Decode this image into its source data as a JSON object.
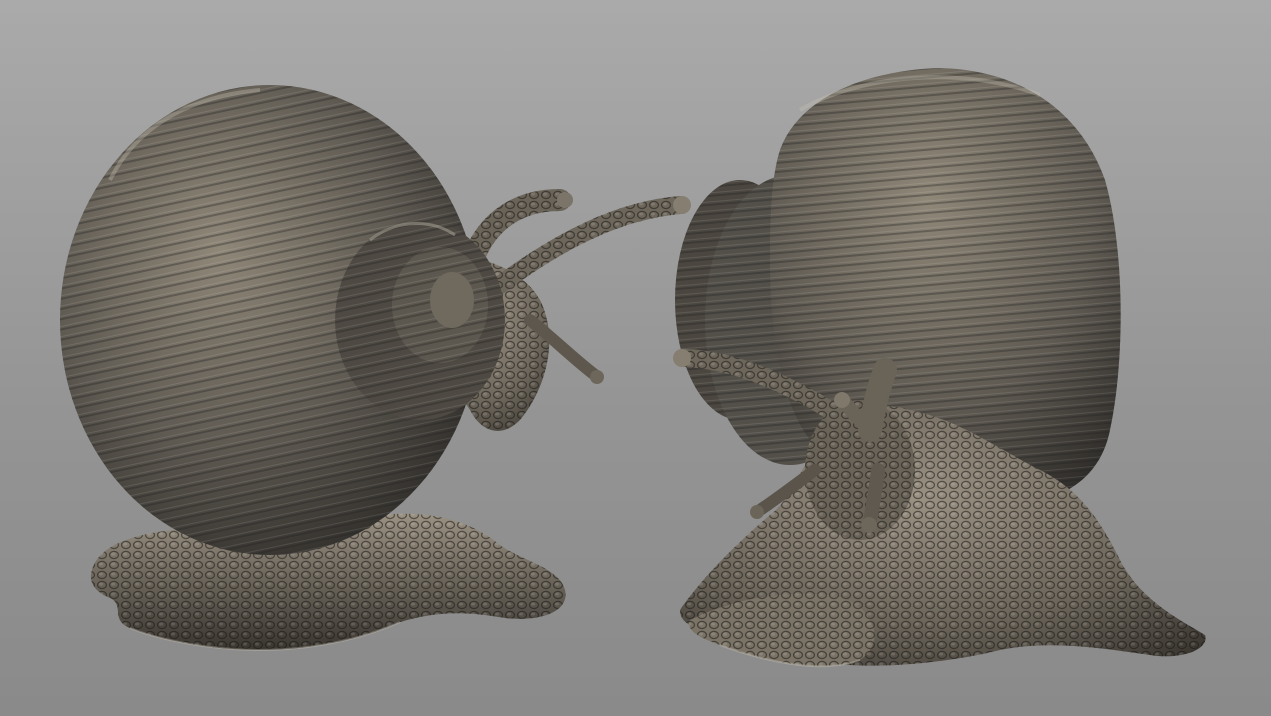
{
  "scene": {
    "subject": "two-snail-sculpts",
    "background": {
      "top_color": "#aaaaaa",
      "mid_color": "#959595",
      "bottom_color": "#8a8a8a"
    },
    "material": {
      "shell_light": "#8f8778",
      "shell_mid": "#5f5a52",
      "shell_dark": "#2c2a27",
      "skin_light": "#9a9182",
      "skin_mid": "#6d665b",
      "skin_dark": "#3a3630",
      "rim_light": "#c8c2b4"
    }
  }
}
